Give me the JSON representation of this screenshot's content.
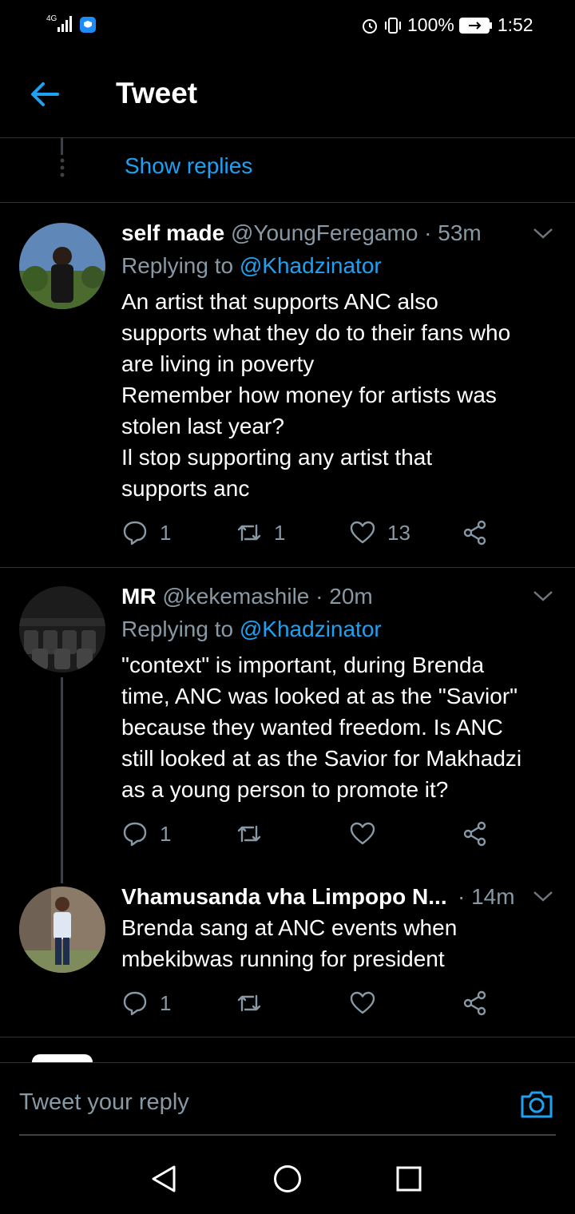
{
  "status_bar": {
    "network": "4G",
    "battery": "100%",
    "time": "1:52"
  },
  "header": {
    "title": "Tweet"
  },
  "show_replies": "Show replies",
  "tweets": [
    {
      "name": "self made",
      "handle": "@YoungFeregamo",
      "time": "· 53m",
      "replying_prefix": "Replying to",
      "replying_handle": "@Khadzinator",
      "text": "An artist that supports ANC also\nsupports what they do to their fans who\nare living in poverty\nRemember how money for artists was\nstolen last year?\nIl stop  supporting any artist that\nsupports anc",
      "replies": "1",
      "retweets": "1",
      "likes": "13"
    },
    {
      "name": "MR",
      "handle": "@kekemashile",
      "time": "· 20m",
      "replying_prefix": "Replying to",
      "replying_handle": "@Khadzinator",
      "text": "\"context\" is important, during Brenda\ntime, ANC was looked at as the \"Savior\"\nbecause they wanted freedom. Is ANC\nstill looked at as the Savior for Makhadzi\nas a young person to promote it?",
      "replies": "1",
      "retweets": "",
      "likes": ""
    },
    {
      "name": "Vhamusanda vha Limpopo N...",
      "handle": "",
      "time": "· 14m",
      "text": "Brenda sang at ANC events when\nmbekibwas running for president",
      "replies": "1",
      "retweets": "",
      "likes": ""
    }
  ],
  "reply_bar": {
    "placeholder": "Tweet your reply"
  },
  "icons": {
    "back": "arrow-left-icon",
    "camera": "camera-icon",
    "reply": "reply-icon",
    "retweet": "retweet-icon",
    "like": "heart-icon",
    "share": "share-icon"
  },
  "colors": {
    "accent": "#1da1f2",
    "muted": "#8899a6",
    "background": "#000000"
  }
}
